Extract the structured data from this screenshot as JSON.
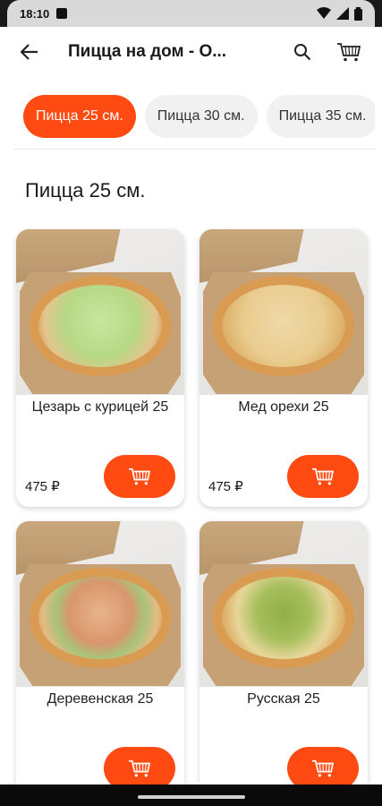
{
  "status": {
    "time": "18:10"
  },
  "appbar": {
    "title": "Пицца на дом - О..."
  },
  "tabs": [
    {
      "label": "Пицца 25 см.",
      "active": true
    },
    {
      "label": "Пицца 30 см.",
      "active": false
    },
    {
      "label": "Пицца 35 см.",
      "active": false
    }
  ],
  "section": {
    "title": "Пицца 25 см."
  },
  "products": [
    {
      "name": "Цезарь с курицей 25",
      "price": "475 ₽",
      "topping": "lettuce"
    },
    {
      "name": "Мед орехи 25",
      "price": "475 ₽",
      "topping": "honey"
    },
    {
      "name": "Деревенская 25",
      "price": "",
      "topping": "herbs"
    },
    {
      "name": "Русская 25",
      "price": "",
      "topping": "pickles"
    }
  ],
  "colors": {
    "accent": "#ff4a12",
    "chip_bg": "#f1f1f1"
  }
}
